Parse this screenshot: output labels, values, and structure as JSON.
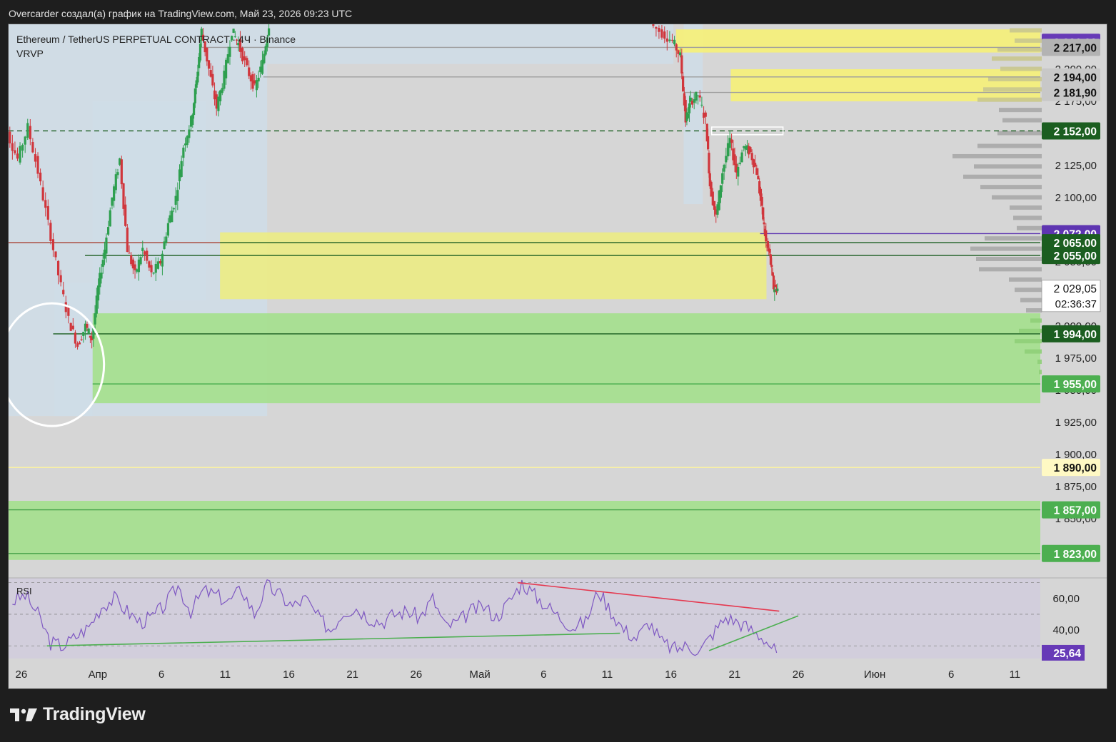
{
  "header": {
    "attribution": "Overcarder создал(а) график на TradingView.com, Май 23, 2026 09:23 UTC"
  },
  "brand": {
    "name": "TradingView",
    "logo_icon": "tradingview-logo-icon"
  },
  "chart_data": {
    "type": "candlestick",
    "title": "Ethereum / TetherUS PERPETUAL CONTRACT · 4Ч · Binance",
    "indicator_label": "VRVP",
    "y_range": [
      1804,
      2235
    ],
    "x_range_days": [
      0,
      81
    ],
    "x_ticks": [
      {
        "label": "26",
        "day": 1
      },
      {
        "label": "Апр",
        "day": 7
      },
      {
        "label": "6",
        "day": 12
      },
      {
        "label": "11",
        "day": 17
      },
      {
        "label": "16",
        "day": 22
      },
      {
        "label": "21",
        "day": 27
      },
      {
        "label": "26",
        "day": 32
      },
      {
        "label": "Май",
        "day": 37
      },
      {
        "label": "6",
        "day": 42
      },
      {
        "label": "11",
        "day": 47
      },
      {
        "label": "16",
        "day": 52
      },
      {
        "label": "21",
        "day": 57
      },
      {
        "label": "26",
        "day": 62
      },
      {
        "label": "Июн",
        "day": 68
      },
      {
        "label": "6",
        "day": 74
      },
      {
        "label": "11",
        "day": 79
      }
    ],
    "y_ticks": [
      {
        "label": "2 200,00",
        "value": 2200
      },
      {
        "label": "2 175,00",
        "value": 2175
      },
      {
        "label": "2 125,00",
        "value": 2125
      },
      {
        "label": "2 100,00",
        "value": 2100
      },
      {
        "label": "2 050,00",
        "value": 2050
      },
      {
        "label": "2 000,00",
        "value": 2000
      },
      {
        "label": "1 975,00",
        "value": 1975
      },
      {
        "label": "1 950,00",
        "value": 1950
      },
      {
        "label": "1 925,00",
        "value": 1925
      },
      {
        "label": "1 900,00",
        "value": 1900
      },
      {
        "label": "1 875,00",
        "value": 1875
      },
      {
        "label": "1 850,00",
        "value": 1850
      }
    ],
    "price_tags": [
      {
        "label": "2 221,00",
        "value": 2221,
        "bg": "#673ab7",
        "fg": "#ffffff"
      },
      {
        "label": "2 217,00",
        "value": 2217,
        "bg": "#b3b3b3",
        "fg": "#111111"
      },
      {
        "label": "2 194,00",
        "value": 2194,
        "bg": "#c8c8c8",
        "fg": "#111111"
      },
      {
        "label": "2 181,90",
        "value": 2181.9,
        "bg": "#c8c8c8",
        "fg": "#111111"
      },
      {
        "label": "2 152,00",
        "value": 2152,
        "bg": "#1b5e20",
        "fg": "#ffffff"
      },
      {
        "label": "2 072,00",
        "value": 2072,
        "bg": "#5e35b1",
        "fg": "#ffffff"
      },
      {
        "label": "2 065,00",
        "value": 2065,
        "bg": "#1b5e20",
        "fg": "#ffffff"
      },
      {
        "label": "2 055,00",
        "value": 2055,
        "bg": "#1b5e20",
        "fg": "#ffffff"
      },
      {
        "label": "1 994,00",
        "value": 1994,
        "bg": "#1b5e20",
        "fg": "#ffffff"
      },
      {
        "label": "1 955,00",
        "value": 1955,
        "bg": "#4caf50",
        "fg": "#ffffff"
      },
      {
        "label": "1 890,00",
        "value": 1890,
        "bg": "#fff9c4",
        "fg": "#111111"
      },
      {
        "label": "1 857,00",
        "value": 1857,
        "bg": "#4caf50",
        "fg": "#ffffff"
      },
      {
        "label": "1 823,00",
        "value": 1823,
        "bg": "#4caf50",
        "fg": "#ffffff"
      }
    ],
    "last_price": {
      "label": "2 029,05",
      "value": 2029.05,
      "countdown": "02:36:37"
    },
    "zones": [
      {
        "name": "yellow-zone-top",
        "from_day": 52.4,
        "to_day": 81,
        "low": 2213,
        "high": 2231,
        "color": "#f5f07a"
      },
      {
        "name": "yellow-zone-mid",
        "from_day": 56.7,
        "to_day": 81,
        "low": 2175,
        "high": 2200,
        "color": "#f5f07a"
      },
      {
        "name": "yellow-zone-big",
        "from_day": 16.6,
        "to_day": 59.5,
        "low": 2021,
        "high": 2073,
        "color": "#ecec86"
      },
      {
        "name": "green-zone-mid",
        "from_day": 6.6,
        "to_day": 81,
        "low": 1940,
        "high": 2010,
        "color": "#a5e08e"
      },
      {
        "name": "green-zone-bottom",
        "from_day": 0,
        "to_day": 81,
        "low": 1818,
        "high": 1864,
        "color": "#a5e08e"
      }
    ],
    "levels": [
      {
        "name": "level-2217",
        "value": 2217,
        "from_day": 15,
        "to_day": 81,
        "color": "#9e9e9e",
        "dash": ""
      },
      {
        "name": "level-2181",
        "value": 2181.9,
        "from_day": 53,
        "to_day": 81,
        "color": "#9e9e9e",
        "dash": ""
      },
      {
        "name": "level-2194",
        "value": 2194,
        "from_day": 20,
        "to_day": 52,
        "color": "#9e9e9e",
        "dash": ""
      },
      {
        "name": "level-2152",
        "value": 2152,
        "from_day": 0,
        "to_day": 81,
        "color": "#1b5e20",
        "dash": "7 5"
      },
      {
        "name": "level-2072",
        "value": 2072,
        "from_day": 59,
        "to_day": 81,
        "color": "#5e35b1",
        "dash": ""
      },
      {
        "name": "level-2065",
        "value": 2065,
        "from_day": 0,
        "to_day": 81,
        "color": "#1b5e20",
        "dash": ""
      },
      {
        "name": "level-2055",
        "value": 2055,
        "from_day": 6,
        "to_day": 81,
        "color": "#1b5e20",
        "dash": ""
      },
      {
        "name": "level-1994",
        "value": 1994,
        "from_day": 3.5,
        "to_day": 81,
        "color": "#1b5e20",
        "dash": ""
      },
      {
        "name": "level-1955",
        "value": 1955,
        "from_day": 6.6,
        "to_day": 81,
        "color": "#4caf50",
        "dash": ""
      },
      {
        "name": "level-1890",
        "value": 1890,
        "from_day": 0,
        "to_day": 81,
        "color": "#fff59d",
        "dash": ""
      },
      {
        "name": "level-1857",
        "value": 1857,
        "from_day": 0,
        "to_day": 81,
        "color": "#43a047",
        "dash": ""
      },
      {
        "name": "level-1823",
        "value": 1823,
        "from_day": 0,
        "to_day": 81,
        "color": "#43a047",
        "dash": ""
      }
    ],
    "price_path": [
      [
        -2,
        2140
      ],
      [
        0,
        2150
      ],
      [
        0.8,
        2130
      ],
      [
        1.6,
        2155
      ],
      [
        2.4,
        2120
      ],
      [
        3.2,
        2080
      ],
      [
        4,
        2040
      ],
      [
        4.8,
        2005
      ],
      [
        5.5,
        1985
      ],
      [
        6.1,
        2000
      ],
      [
        6.6,
        1990
      ],
      [
        7.1,
        2030
      ],
      [
        7.6,
        2060
      ],
      [
        8.2,
        2100
      ],
      [
        8.8,
        2130
      ],
      [
        9.4,
        2060
      ],
      [
        10,
        2040
      ],
      [
        10.6,
        2060
      ],
      [
        11.3,
        2040
      ],
      [
        12,
        2050
      ],
      [
        12.6,
        2080
      ],
      [
        13.2,
        2100
      ],
      [
        13.8,
        2140
      ],
      [
        14.4,
        2160
      ],
      [
        14.8,
        2190
      ],
      [
        15.2,
        2230
      ],
      [
        15.8,
        2200
      ],
      [
        16.4,
        2170
      ],
      [
        17,
        2195
      ],
      [
        17.6,
        2230
      ],
      [
        18.1,
        2220
      ],
      [
        18.8,
        2200
      ],
      [
        19.4,
        2185
      ],
      [
        20,
        2205
      ],
      [
        20.5,
        2235
      ]
    ],
    "price_path_2": [
      [
        50.5,
        2235
      ],
      [
        51.4,
        2228
      ],
      [
        52.2,
        2222
      ],
      [
        52.8,
        2210
      ],
      [
        53.2,
        2160
      ],
      [
        53.6,
        2175
      ],
      [
        54.2,
        2180
      ],
      [
        54.8,
        2160
      ],
      [
        55.1,
        2110
      ],
      [
        55.6,
        2085
      ],
      [
        56.1,
        2120
      ],
      [
        56.7,
        2145
      ],
      [
        57.2,
        2120
      ],
      [
        57.8,
        2140
      ],
      [
        58.3,
        2135
      ],
      [
        58.8,
        2120
      ],
      [
        59.2,
        2090
      ],
      [
        59.5,
        2065
      ],
      [
        59.8,
        2055
      ],
      [
        60.1,
        2030
      ],
      [
        60.4,
        2029
      ]
    ],
    "vrvp_bars": [
      [
        2230,
        45
      ],
      [
        2222,
        38
      ],
      [
        2215,
        62
      ],
      [
        2208,
        70
      ],
      [
        2200,
        58
      ],
      [
        2192,
        75
      ],
      [
        2184,
        82
      ],
      [
        2176,
        90
      ],
      [
        2168,
        60
      ],
      [
        2160,
        55
      ],
      [
        2150,
        62
      ],
      [
        2140,
        90
      ],
      [
        2132,
        125
      ],
      [
        2124,
        95
      ],
      [
        2116,
        110
      ],
      [
        2108,
        86
      ],
      [
        2100,
        70
      ],
      [
        2092,
        45
      ],
      [
        2084,
        40
      ],
      [
        2076,
        35
      ],
      [
        2068,
        80
      ],
      [
        2060,
        100
      ],
      [
        2052,
        92
      ],
      [
        2044,
        88
      ],
      [
        2036,
        46
      ],
      [
        2028,
        38
      ],
      [
        2020,
        30
      ],
      [
        2012,
        22
      ],
      [
        2004,
        16
      ],
      [
        1996,
        32
      ],
      [
        1988,
        38
      ],
      [
        1980,
        24
      ],
      [
        1972,
        6
      ],
      [
        1964,
        4
      ]
    ],
    "annotation": {
      "type": "circle",
      "center_day": 3.4,
      "center_value": 1970,
      "note": "hand-drawn circle"
    },
    "rsi": {
      "label": "RSI",
      "y_range": [
        22,
        73
      ],
      "upper_band": 70,
      "lower_band": 30,
      "mid_band": 50,
      "value_label": "25,64",
      "value": 25.64,
      "ticks": [
        {
          "label": "60,00",
          "value": 60
        },
        {
          "label": "40,00",
          "value": 40
        }
      ],
      "series": [
        [
          0,
          58
        ],
        [
          1,
          62
        ],
        [
          2,
          50
        ],
        [
          3,
          32
        ],
        [
          4,
          30
        ],
        [
          5,
          36
        ],
        [
          6,
          42
        ],
        [
          7,
          55
        ],
        [
          8,
          60
        ],
        [
          9,
          52
        ],
        [
          10,
          45
        ],
        [
          11,
          48
        ],
        [
          12,
          56
        ],
        [
          13,
          68
        ],
        [
          14,
          52
        ],
        [
          15,
          65
        ],
        [
          16,
          62
        ],
        [
          17,
          58
        ],
        [
          18,
          66
        ],
        [
          19,
          50
        ],
        [
          20,
          68
        ],
        [
          21,
          62
        ],
        [
          22,
          55
        ],
        [
          23,
          60
        ],
        [
          24,
          48
        ],
        [
          25,
          40
        ],
        [
          26,
          52
        ],
        [
          27,
          54
        ],
        [
          28,
          48
        ],
        [
          29,
          45
        ],
        [
          30,
          50
        ],
        [
          31,
          52
        ],
        [
          32,
          48
        ],
        [
          33,
          60
        ],
        [
          34,
          42
        ],
        [
          35,
          45
        ],
        [
          36,
          52
        ],
        [
          37,
          55
        ],
        [
          38,
          48
        ],
        [
          39,
          58
        ],
        [
          40,
          70
        ],
        [
          41,
          62
        ],
        [
          42,
          55
        ],
        [
          43,
          48
        ],
        [
          44,
          42
        ],
        [
          45,
          45
        ],
        [
          46,
          65
        ],
        [
          47,
          52
        ],
        [
          48,
          40
        ],
        [
          49,
          35
        ],
        [
          50,
          45
        ],
        [
          51,
          32
        ],
        [
          52,
          28
        ],
        [
          53,
          30
        ],
        [
          54,
          27
        ],
        [
          55,
          38
        ],
        [
          56,
          48
        ],
        [
          57,
          45
        ],
        [
          58,
          40
        ],
        [
          59,
          35
        ],
        [
          60,
          25.6
        ]
      ],
      "trendlines": [
        {
          "name": "rsi-trend-green-long",
          "from": [
            3,
            30
          ],
          "to": [
            48,
            38
          ],
          "color": "#4caf50"
        },
        {
          "name": "rsi-trend-red",
          "from": [
            40,
            70
          ],
          "to": [
            60.5,
            52
          ],
          "color": "#e53950"
        },
        {
          "name": "rsi-trend-green-short",
          "from": [
            55,
            27
          ],
          "to": [
            62,
            49
          ],
          "color": "#4caf50"
        }
      ]
    }
  }
}
